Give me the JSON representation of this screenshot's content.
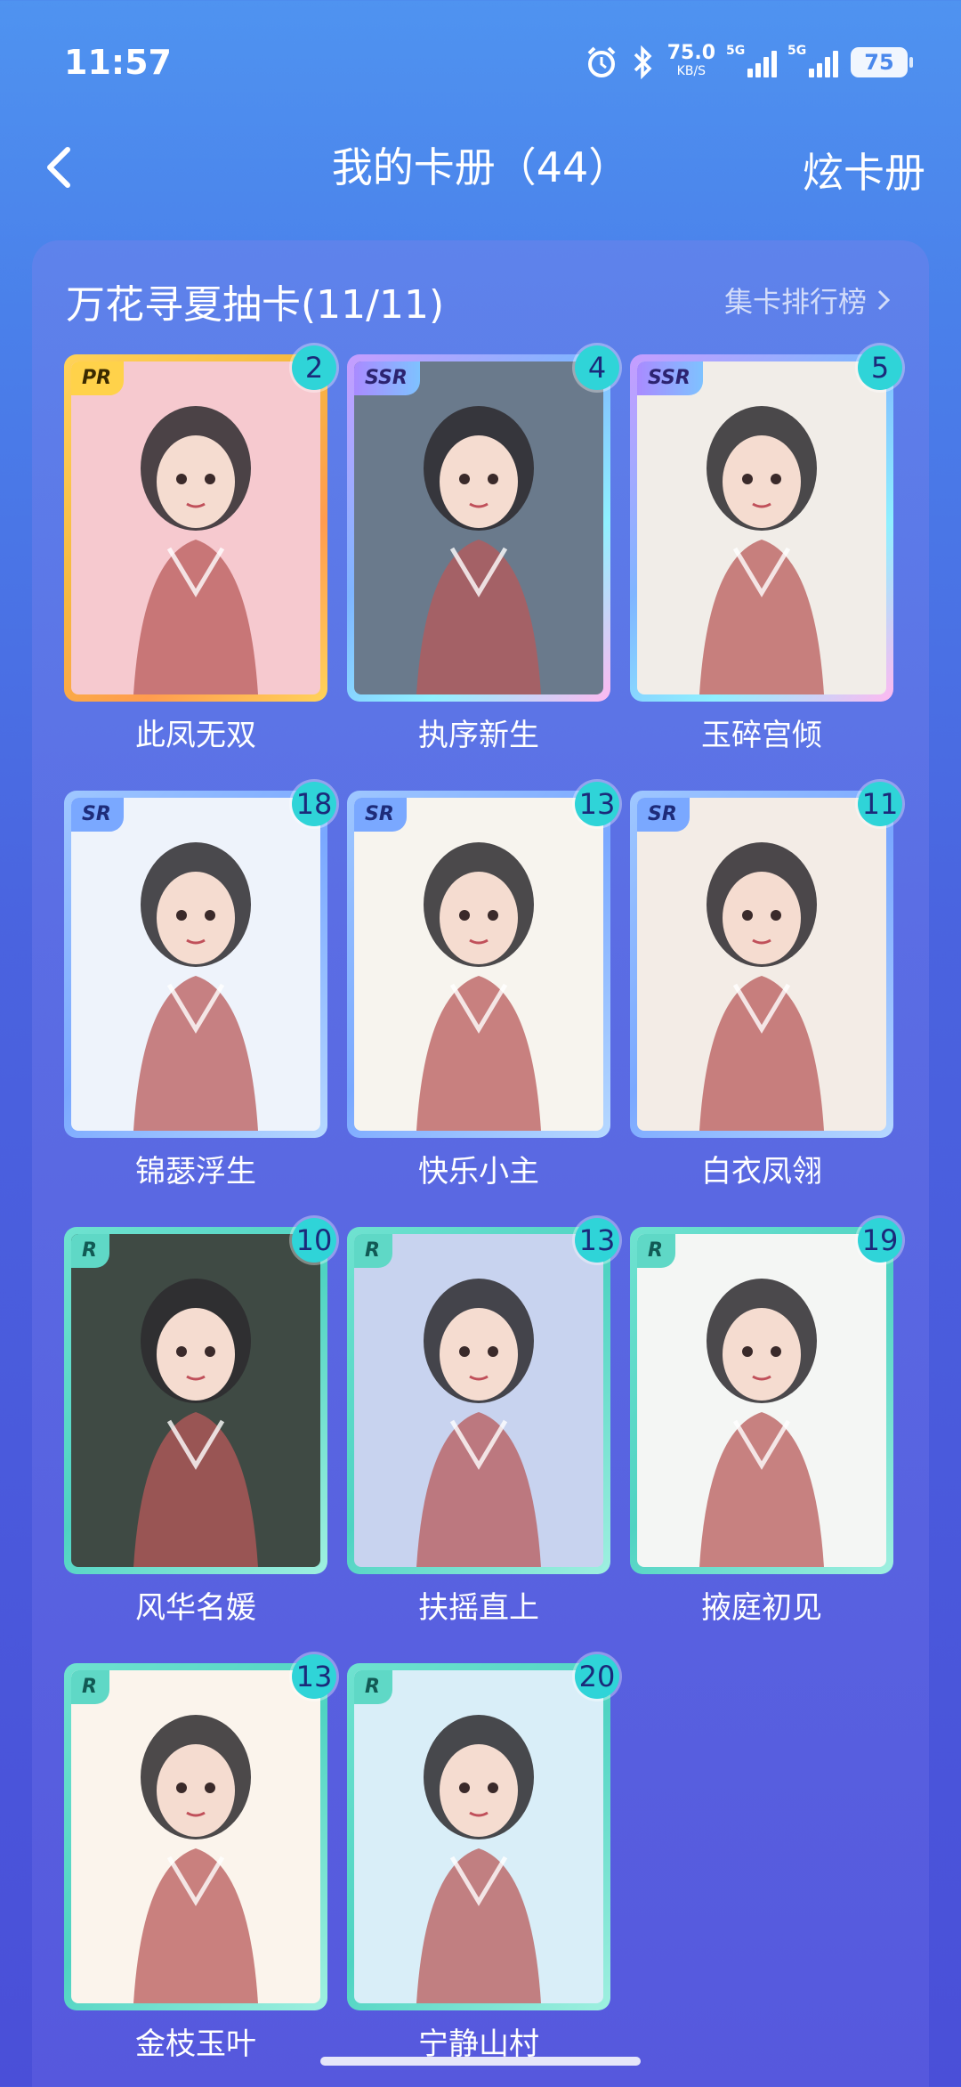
{
  "status_bar": {
    "time": "11:57",
    "speed_value": "75.0",
    "speed_unit": "KB/S",
    "sig1_label": "5G",
    "sig2_label": "5G",
    "battery": "75"
  },
  "header": {
    "title": "我的卡册（44）",
    "action": "炫卡册",
    "back_icon": "chevron-left-icon"
  },
  "section": {
    "title": "万花寻夏抽卡(11/11)",
    "ranking_label": "集卡排行榜"
  },
  "cards": [
    {
      "name": "此凤无双",
      "rarity": "PR",
      "count": "2",
      "bg": "#f6c9cf"
    },
    {
      "name": "执序新生",
      "rarity": "SSR",
      "count": "4",
      "bg": "#6a7a8c"
    },
    {
      "name": "玉碎宫倾",
      "rarity": "SSR",
      "count": "5",
      "bg": "#f1ede8"
    },
    {
      "name": "锦瑟浮生",
      "rarity": "SR",
      "count": "18",
      "bg": "#eef3fb"
    },
    {
      "name": "快乐小主",
      "rarity": "SR",
      "count": "13",
      "bg": "#f7f4ee"
    },
    {
      "name": "白衣凤翎",
      "rarity": "SR",
      "count": "11",
      "bg": "#f3ece6"
    },
    {
      "name": "风华名媛",
      "rarity": "R",
      "count": "10",
      "bg": "#3f4a44"
    },
    {
      "name": "扶摇直上",
      "rarity": "R",
      "count": "13",
      "bg": "#c8d3ef"
    },
    {
      "name": "掖庭初见",
      "rarity": "R",
      "count": "19",
      "bg": "#f4f6f4"
    },
    {
      "name": "金枝玉叶",
      "rarity": "R",
      "count": "13",
      "bg": "#fbf4ec"
    },
    {
      "name": "宁静山村",
      "rarity": "R",
      "count": "20",
      "bg": "#d9eef8"
    }
  ]
}
